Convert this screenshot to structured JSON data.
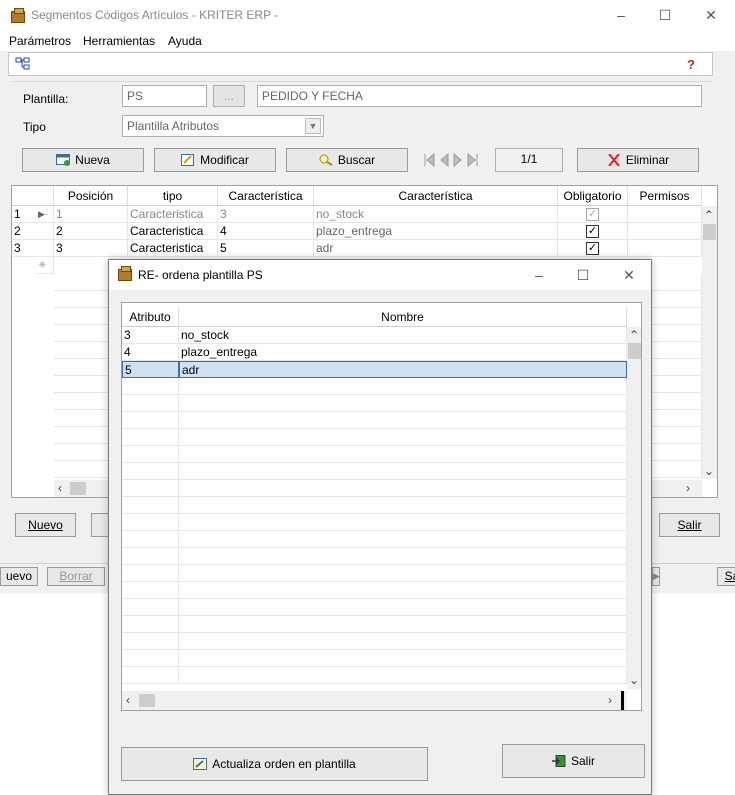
{
  "window": {
    "title": "Segmentos Códigos Artículos - KRITER ERP -",
    "minimize": "–",
    "maximize": "☐",
    "close": "✕"
  },
  "menu": [
    "Parámetros",
    "Herramientas",
    "Ayuda"
  ],
  "form": {
    "plantilla_label": "Plantilla:",
    "plantilla_code": "PS",
    "browse_button": "...",
    "plantilla_desc": "PEDIDO Y FECHA",
    "tipo_label": "Tipo",
    "tipo_value": "Plantilla Atributos"
  },
  "toolbar": {
    "nueva": "Nueva",
    "modificar": "Modificar",
    "buscar": "Buscar",
    "record": "1/1",
    "eliminar": "Eliminar"
  },
  "grid": {
    "headers": [
      "Posición",
      "tipo",
      "Característica",
      "Característica",
      "Obligatorio",
      "Permisos"
    ],
    "rows": [
      {
        "n": "1",
        "pos": "1",
        "tipo": "Caracteristica",
        "car": "3",
        "nombre": "no_stock",
        "obligatorio": true
      },
      {
        "n": "2",
        "pos": "2",
        "tipo": "Caracteristica",
        "car": "4",
        "nombre": "plazo_entrega",
        "obligatorio": true
      },
      {
        "n": "3",
        "pos": "3",
        "tipo": "Caracteristica",
        "car": "5",
        "nombre": "adr",
        "obligatorio": true
      }
    ]
  },
  "bottom": {
    "nuevo": "Nuevo",
    "salir": "Salir",
    "nuevo_back": "uevo",
    "borrar_back": "Borrar",
    "salir_back": "Sa"
  },
  "dialog": {
    "title": "RE- ordena plantilla PS",
    "headers": [
      "Atributo",
      "Nombre"
    ],
    "rows": [
      {
        "atributo": "3",
        "nombre": "no_stock"
      },
      {
        "atributo": "4",
        "nombre": "plazo_entrega"
      },
      {
        "atributo": "5",
        "nombre": "adr"
      }
    ],
    "selected_row": 2,
    "actualiza": "Actualiza orden en plantilla",
    "salir": "Salir"
  },
  "colors": {
    "accent_blue": "#3c6ea5",
    "selection": "#cfe0f3",
    "eliminar_x": "#e02020"
  }
}
